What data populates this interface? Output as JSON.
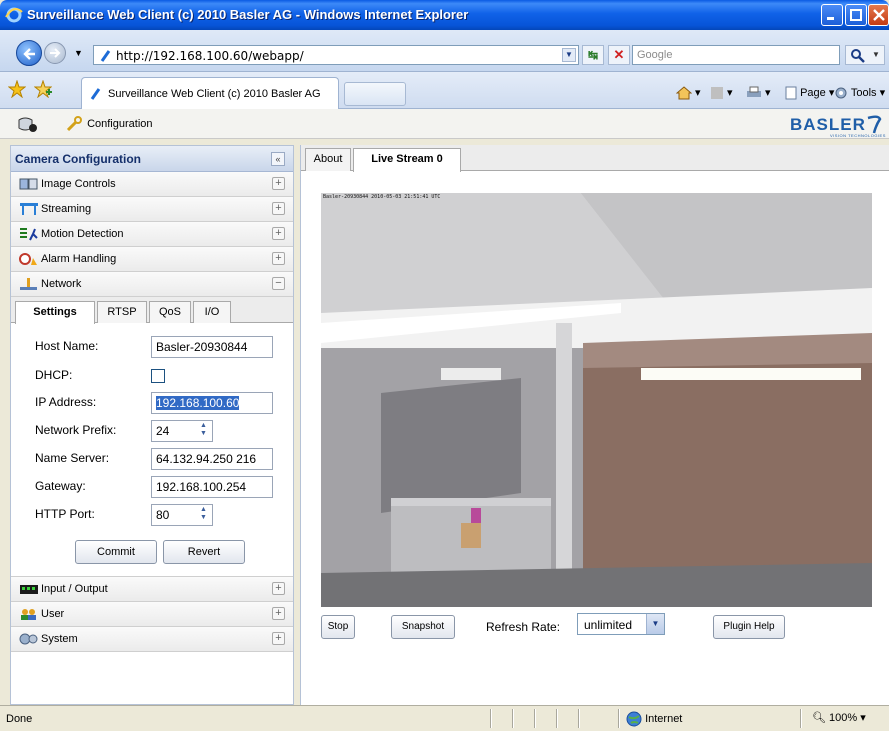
{
  "window": {
    "title": "Surveillance Web Client (c) 2010 Basler AG - Windows Internet Explorer"
  },
  "address_bar": {
    "url": "http://192.168.100.60/webapp/",
    "search_placeholder": "Google"
  },
  "tabbar": {
    "tab_title": "Surveillance Web Client (c) 2010 Basler AG",
    "page_menu": "Page",
    "tools_menu": "Tools"
  },
  "app_header": {
    "configuration_link": "Configuration",
    "brand": "BASLER",
    "brand_sub": "VISION TECHNOLOGIES"
  },
  "left_panel": {
    "title": "Camera Configuration",
    "collapse_symbol": "«",
    "sections_top": [
      {
        "label": "Image Controls",
        "toggle": "+",
        "icon": "image-controls-icon"
      },
      {
        "label": "Streaming",
        "toggle": "+",
        "icon": "streaming-icon"
      },
      {
        "label": "Motion Detection",
        "toggle": "+",
        "icon": "motion-detection-icon"
      },
      {
        "label": "Alarm Handling",
        "toggle": "+",
        "icon": "alarm-handling-icon"
      },
      {
        "label": "Network",
        "toggle": "−",
        "icon": "network-icon"
      }
    ],
    "network_tabs": [
      "Settings",
      "RTSP",
      "QoS",
      "I/O"
    ],
    "active_network_tab": "Settings",
    "fields": {
      "host_name": {
        "label": "Host Name:",
        "value": "Basler-20930844"
      },
      "dhcp": {
        "label": "DHCP:",
        "checked": false
      },
      "ip_address": {
        "label": "IP Address:",
        "value": "192.168.100.60"
      },
      "network_prefix": {
        "label": "Network Prefix:",
        "value": "24"
      },
      "name_server": {
        "label": "Name Server:",
        "value": "64.132.94.250 216"
      },
      "gateway": {
        "label": "Gateway:",
        "value": "192.168.100.254"
      },
      "http_port": {
        "label": "HTTP Port:",
        "value": "80"
      }
    },
    "buttons": {
      "commit": "Commit",
      "revert": "Revert"
    },
    "sections_bottom": [
      {
        "label": "Input / Output",
        "toggle": "+",
        "icon": "input-output-icon"
      },
      {
        "label": "User",
        "toggle": "+",
        "icon": "user-icon"
      },
      {
        "label": "System",
        "toggle": "+",
        "icon": "system-icon"
      }
    ]
  },
  "main": {
    "tabs": [
      "About",
      "Live Stream 0"
    ],
    "active_tab": "Live Stream 0",
    "video_overlay": "Basler-20930844 2010-05-03 21:51:41 UTC",
    "buttons": {
      "stop": "Stop",
      "snapshot": "Snapshot",
      "plugin_help": "Plugin Help"
    },
    "refresh_rate": {
      "label": "Refresh Rate:",
      "value": "unlimited"
    }
  },
  "status_bar": {
    "status": "Done",
    "zone": "Internet",
    "zoom": "100%"
  },
  "colors": {
    "titlebar_blue": "#0754d8",
    "brand_blue": "#1f5ea8",
    "panel_header_text": "#15306b",
    "selection": "#316ac5"
  }
}
